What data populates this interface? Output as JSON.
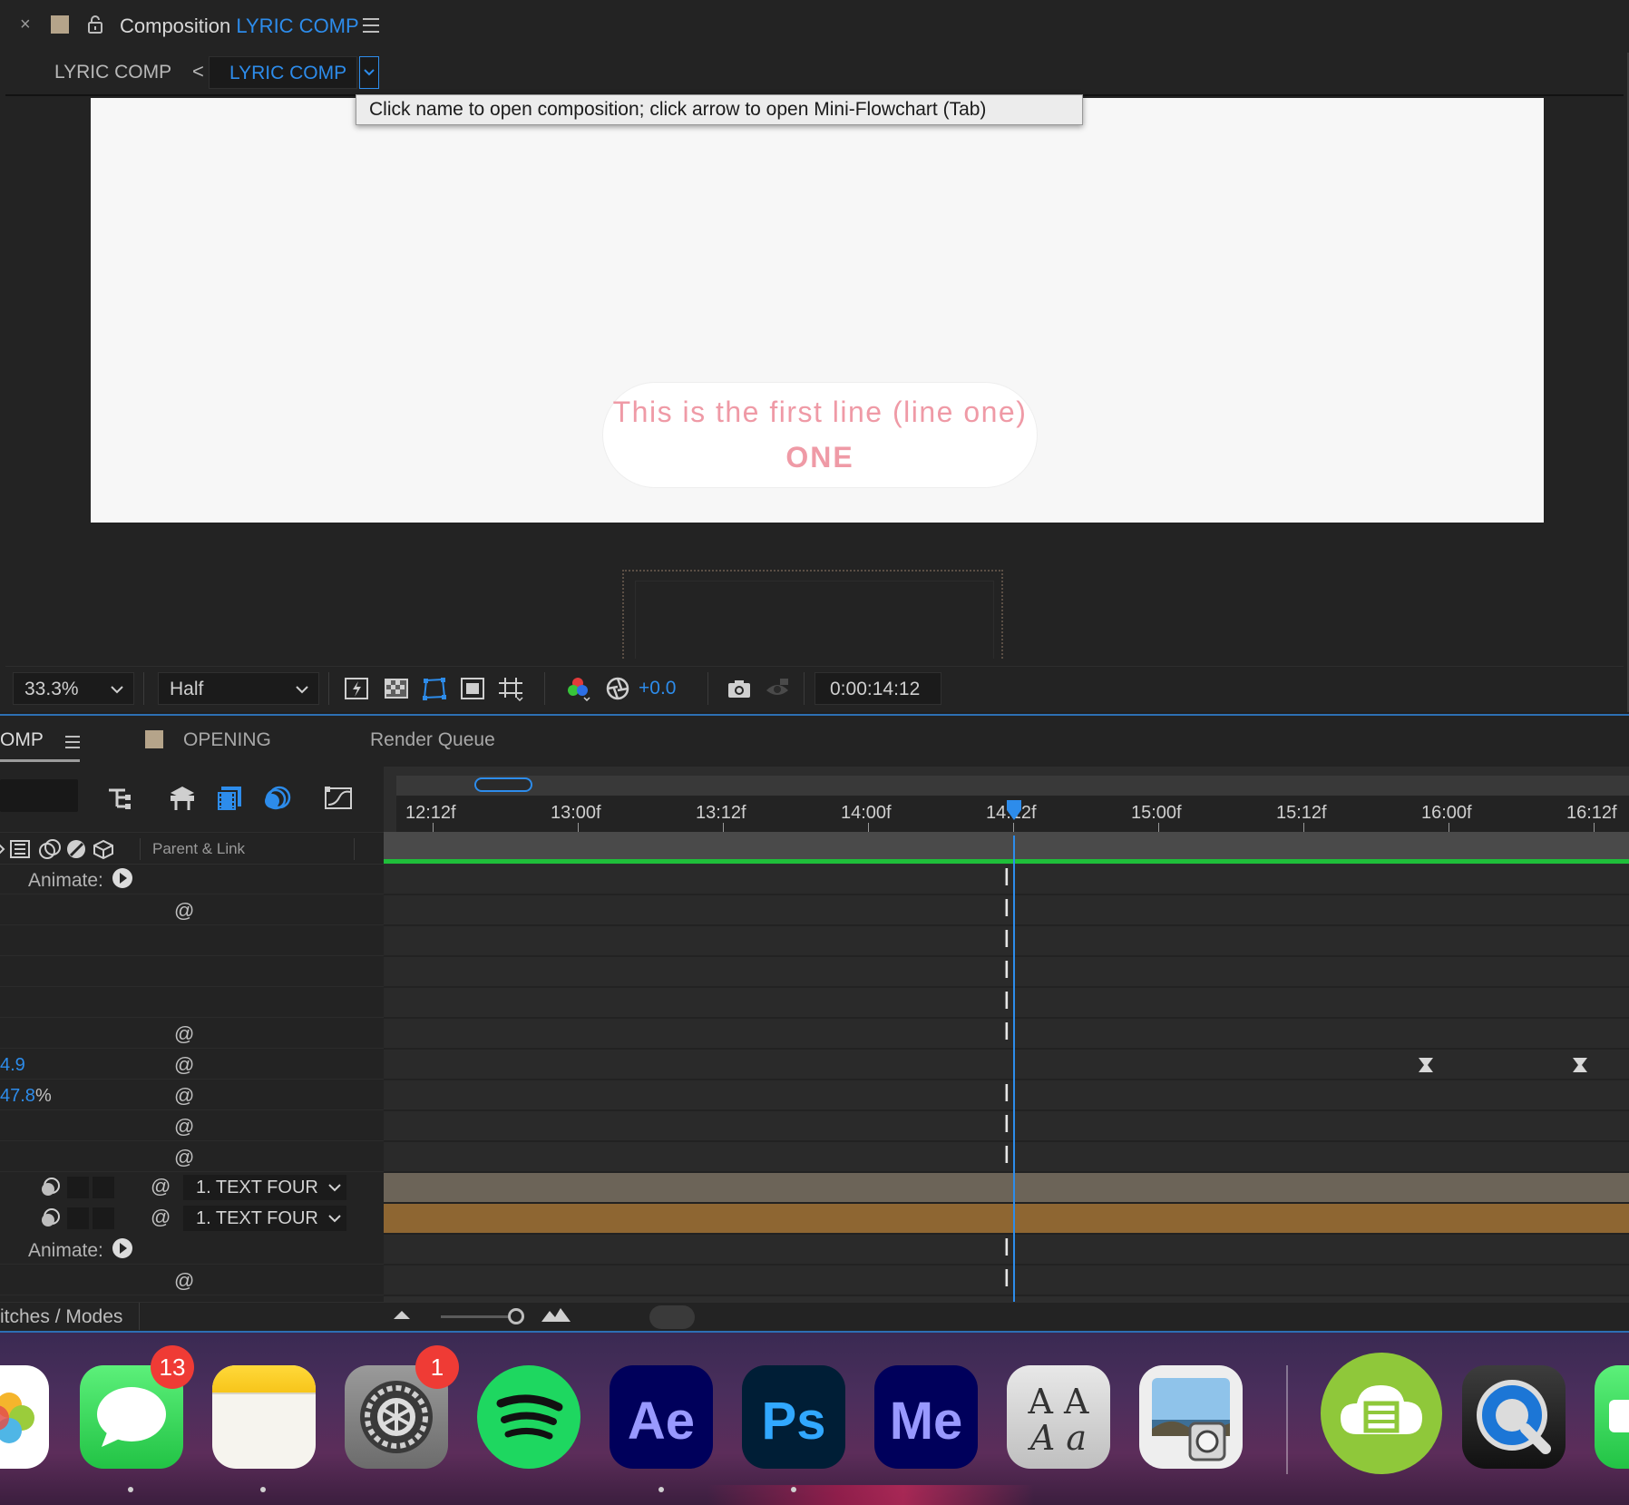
{
  "colors": {
    "accent": "#2d8ceb",
    "comp_swatch": "#b5a48a",
    "pink_text": "#ef9aa6",
    "green_bar": "#1fbe3a",
    "layer_a": "#6c6458",
    "layer_b": "#8e6632"
  },
  "comp_panel": {
    "close": "×",
    "title_prefix": "Composition",
    "title_name": "LYRIC COMP",
    "breadcrumb_parent": "LYRIC COMP",
    "breadcrumb_arrow": "<",
    "breadcrumb_active": "LYRIC COMP",
    "tooltip": "Click name to open composition; click arrow to open Mini-Flowchart (Tab)",
    "canvas_line1": "This is the first line (line one)",
    "canvas_line2": "ONE"
  },
  "viewer_toolbar": {
    "zoom": "33.3%",
    "resolution": "Half",
    "exposure": "+0.0",
    "timecode": "0:00:14:12",
    "icons": [
      "fast-previews-icon",
      "transparency-grid-icon",
      "mask-visibility-icon",
      "region-of-interest-icon",
      "grid-guides-icon",
      "color-channels-icon",
      "reset-exposure-icon",
      "snapshot-icon",
      "show-snapshot-icon"
    ]
  },
  "timeline": {
    "tabs": {
      "comp": "OMP",
      "opening": "OPENING",
      "render_queue": "Render Queue"
    },
    "parent_link_header": "Parent & Link",
    "animate_label": "Animate:",
    "values": {
      "v1": "4.9",
      "v2": "47.8",
      "v2_unit": "%"
    },
    "parent_value": "1. TEXT FOUR",
    "ruler": [
      "12:12f",
      "13:00f",
      "13:12f",
      "14:00f",
      "14:12f",
      "15:00f",
      "15:12f",
      "16:00f",
      "16:12f"
    ],
    "current_time_marker": "14:12f",
    "switches_modes": "itches / Modes"
  },
  "dock": {
    "apps": [
      {
        "name": "Photos"
      },
      {
        "name": "Messages",
        "badge": "13"
      },
      {
        "name": "Notes"
      },
      {
        "name": "System Preferences",
        "badge": "1"
      },
      {
        "name": "Spotify"
      },
      {
        "name": "After Effects",
        "label": "Ae"
      },
      {
        "name": "Photoshop",
        "label": "Ps"
      },
      {
        "name": "Media Encoder",
        "label": "Me"
      },
      {
        "name": "Font Book",
        "label_top": "A A",
        "label_bottom": "A a"
      },
      {
        "name": "Preview"
      },
      {
        "name": "4K Video Downloader"
      },
      {
        "name": "QuickTime Player"
      },
      {
        "name": "FaceTime"
      }
    ]
  }
}
